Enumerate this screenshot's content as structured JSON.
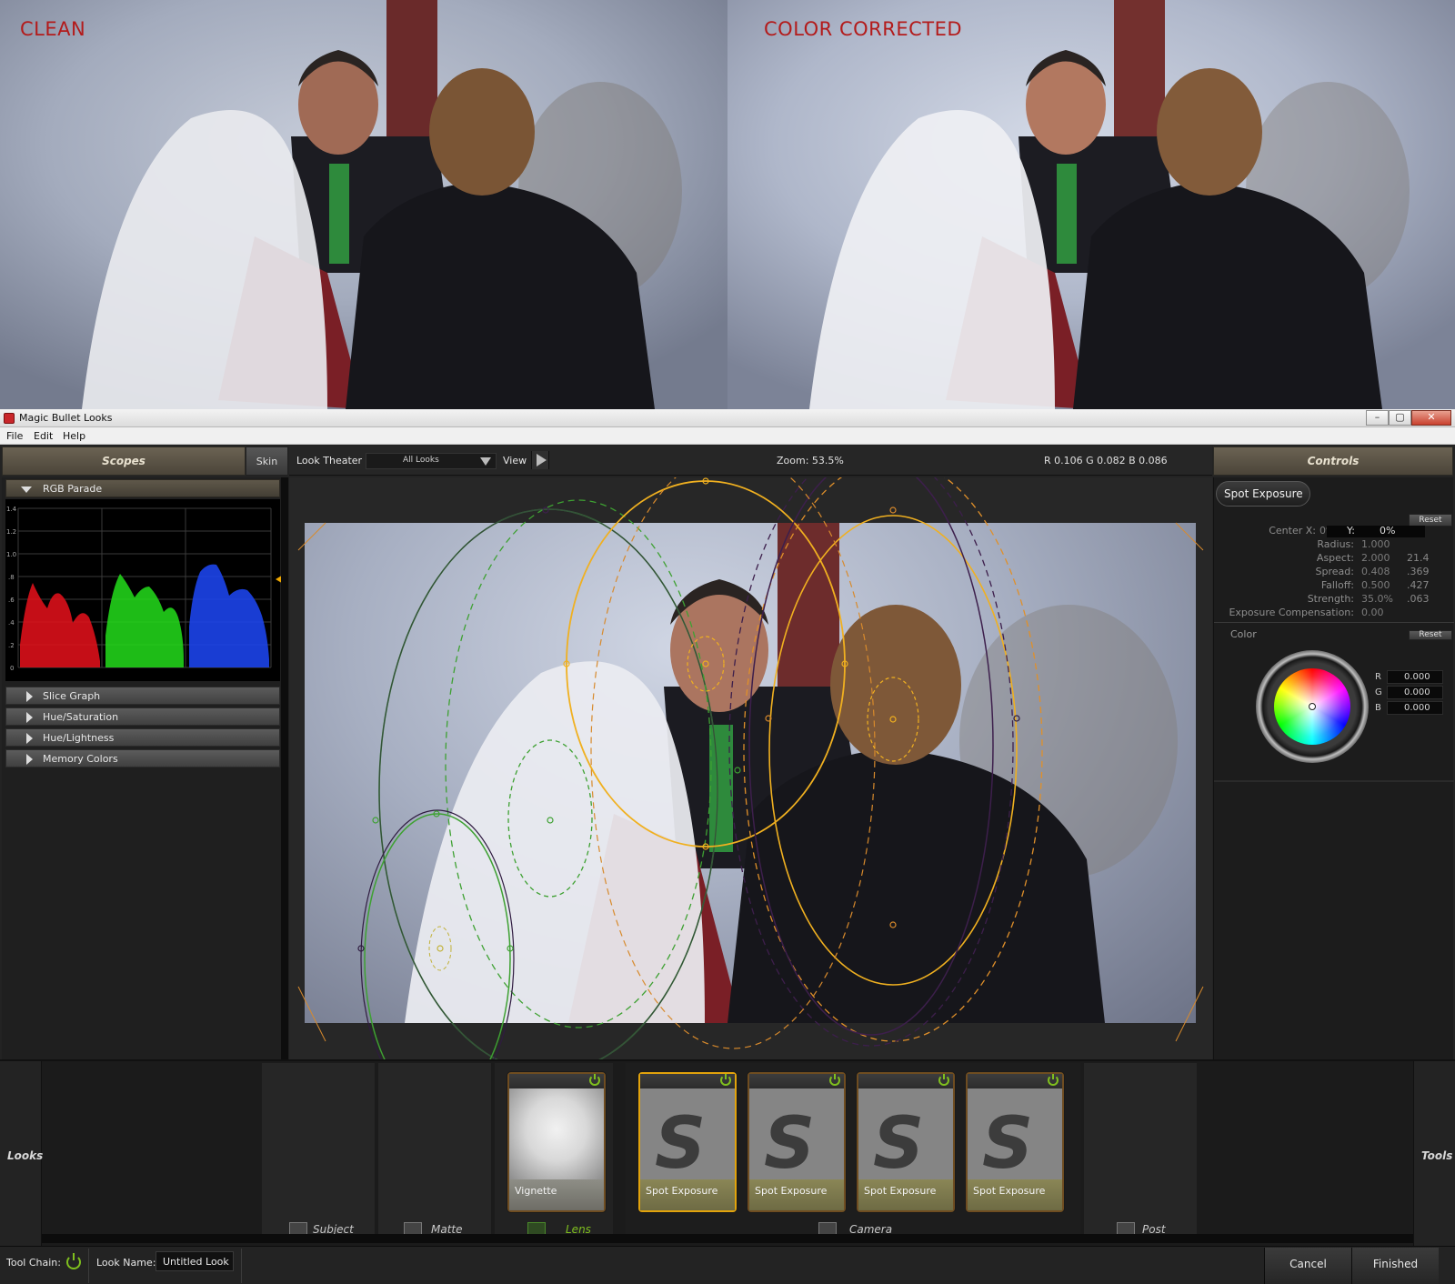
{
  "comparison": {
    "left_label": "CLEAN",
    "right_label": "COLOR CORRECTED"
  },
  "window": {
    "title": "Magic Bullet Looks",
    "controls": {
      "minimize": "–",
      "maximize": "▢",
      "close": "✕"
    }
  },
  "menu": [
    "File",
    "Edit",
    "Help"
  ],
  "scopes": {
    "header": "Scopes",
    "skin_button": "Skin",
    "rgb_parade": {
      "title": "RGB Parade",
      "y_ticks": [
        "1.4",
        "1.2",
        "1.0",
        ".8",
        ".6",
        ".4",
        ".2",
        "0"
      ]
    },
    "collapsed_sections": [
      "Slice Graph",
      "Hue/Saturation",
      "Hue/Lightness",
      "Memory Colors"
    ]
  },
  "look_theater": {
    "label": "Look Theater",
    "filter_value": "All Looks",
    "view_button": "View",
    "zoom": "Zoom:  53.5%",
    "pixel_readout": "R 0.106   G 0.082   B 0.086"
  },
  "controls": {
    "header": "Controls",
    "tool_title": "Spot Exposure",
    "reset_label": "Reset",
    "center_x_label": "Center X:",
    "center_x_value": "0%",
    "center_y_label": "Y:",
    "center_y_value": "0%",
    "params": [
      {
        "label": "Radius:",
        "value": "1.000",
        "value2": ""
      },
      {
        "label": "Aspect:",
        "value": "2.000",
        "value2": "21.4"
      },
      {
        "label": "Spread:",
        "value": "0.408",
        "value2": ".369"
      },
      {
        "label": "Falloff:",
        "value": "0.500",
        "value2": ".427"
      },
      {
        "label": "Strength:",
        "value": "35.0%",
        "value2": ".063"
      },
      {
        "label": "Exposure Compensation:",
        "value": "0.00",
        "value2": ""
      }
    ],
    "color_label": "Color",
    "color_reset_label": "Reset",
    "rgb": [
      {
        "channel": "R",
        "value": "0.000"
      },
      {
        "channel": "G",
        "value": "0.000"
      },
      {
        "channel": "B",
        "value": "0.000"
      }
    ]
  },
  "looks_area": {
    "left_label": "Looks",
    "right_label": "Tools",
    "categories": [
      "Subject",
      "Matte",
      "Lens",
      "Camera",
      "Post"
    ],
    "tiles": [
      {
        "name": "Vignette",
        "category": "Lens"
      },
      {
        "name": "Spot Exposure",
        "category": "Camera"
      },
      {
        "name": "Spot Exposure",
        "category": "Camera"
      },
      {
        "name": "Spot Exposure",
        "category": "Camera"
      },
      {
        "name": "Spot Exposure",
        "category": "Camera"
      }
    ]
  },
  "statusbar": {
    "tool_chain_label": "Tool Chain:",
    "look_name_label": "Look Name:",
    "look_name_value": "Untitled Look",
    "cancel_label": "Cancel",
    "finished_label": "Finished"
  },
  "colors": {
    "accent_gold": "#e2a30c",
    "label_red": "#b31b1b",
    "power_green": "#7fbf1e",
    "overlay_green": "#39a02c",
    "overlay_gold": "#f0b020",
    "overlay_purple": "#3c1e4a"
  }
}
